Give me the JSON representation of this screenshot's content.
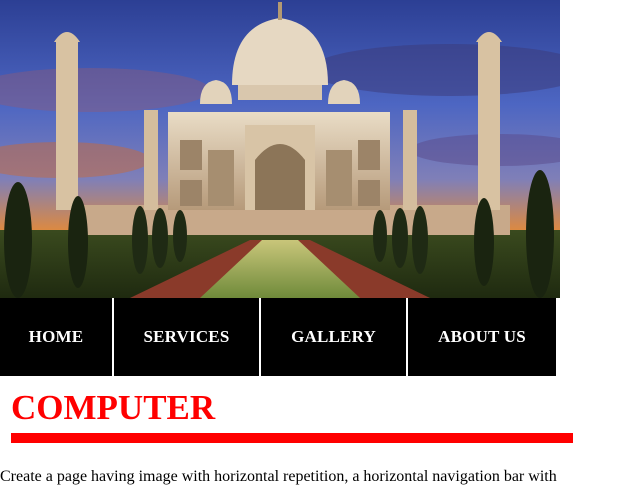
{
  "banner": {
    "alt_icon": "taj-mahal-photo"
  },
  "nav": {
    "items": [
      {
        "label": "HOME"
      },
      {
        "label": "SERVICES"
      },
      {
        "label": "GALLERY"
      },
      {
        "label": "ABOUT US"
      }
    ]
  },
  "content": {
    "title": "COMPUTER",
    "paragraph": "Create a page having image with horizontal repetition, a horizontal navigation bar with"
  },
  "colors": {
    "nav_bg": "#000000",
    "nav_text": "#ffffff",
    "title": "#ff0000",
    "rule": "#ff0000"
  }
}
